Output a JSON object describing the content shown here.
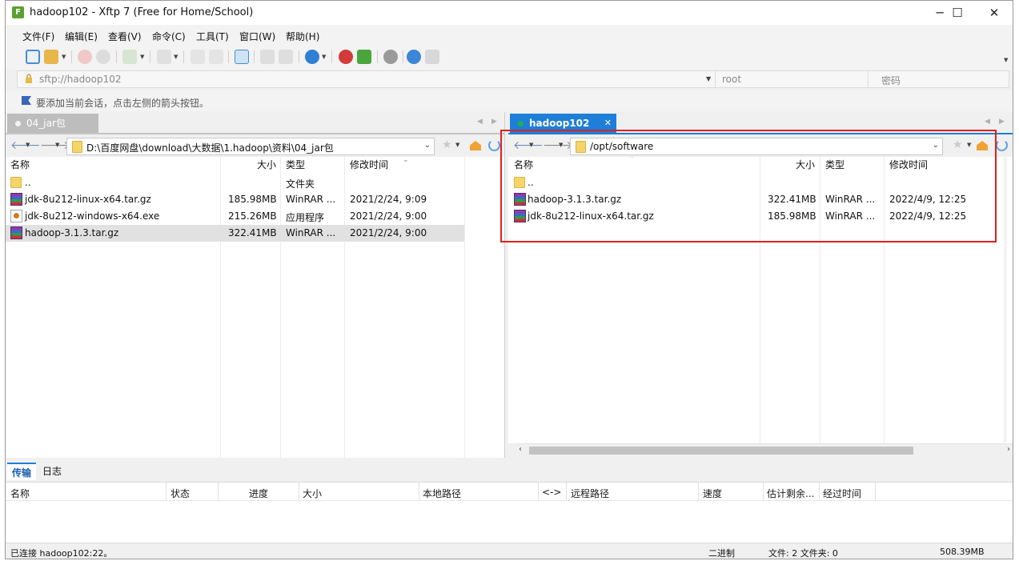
{
  "window": {
    "title": "hadoop102 - Xftp 7 (Free for Home/School)",
    "app_icon": "xftp-icon",
    "minimize": "─",
    "maximize": "☐",
    "close": "✕"
  },
  "menu": [
    "文件(F)",
    "编辑(E)",
    "查看(V)",
    "命令(C)",
    "工具(T)",
    "窗口(W)",
    "帮助(H)"
  ],
  "address": {
    "url": "sftp://hadoop102",
    "user_placeholder": "root",
    "password_placeholder": "密码"
  },
  "hint": "要添加当前会话，点击左侧的箭头按钮。",
  "left_pane": {
    "tab": "04_jar包",
    "path": "D:\\百度网盘\\download\\大数据\\1.hadoop\\资料\\04_jar包",
    "columns": [
      "名称",
      "大小",
      "类型",
      "修改时间"
    ],
    "rows": [
      {
        "icon": "folder-icon",
        "name": "..",
        "size": "",
        "type": "文件夹",
        "modified": ""
      },
      {
        "icon": "winrar-icon",
        "name": "jdk-8u212-linux-x64.tar.gz",
        "size": "185.98MB",
        "type": "WinRAR ...",
        "modified": "2021/2/24, 9:09"
      },
      {
        "icon": "exe-icon",
        "name": "jdk-8u212-windows-x64.exe",
        "size": "215.26MB",
        "type": "应用程序",
        "modified": "2021/2/24, 9:00"
      },
      {
        "icon": "winrar-icon",
        "name": "hadoop-3.1.3.tar.gz",
        "size": "322.41MB",
        "type": "WinRAR ...",
        "modified": "2021/2/24, 9:00",
        "selected": true
      }
    ]
  },
  "right_pane": {
    "tab": "hadoop102",
    "tab_status_color": "#22b14c",
    "path": "/opt/software",
    "columns": [
      "名称",
      "大小",
      "类型",
      "修改时间"
    ],
    "rows": [
      {
        "icon": "folder-icon",
        "name": "..",
        "size": "",
        "type": "",
        "modified": ""
      },
      {
        "icon": "winrar-icon",
        "name": "hadoop-3.1.3.tar.gz",
        "size": "322.41MB",
        "type": "WinRAR ...",
        "modified": "2022/4/9, 12:25"
      },
      {
        "icon": "winrar-icon",
        "name": "jdk-8u212-linux-x64.tar.gz",
        "size": "185.98MB",
        "type": "WinRAR ...",
        "modified": "2022/4/9, 12:25"
      }
    ]
  },
  "transfer": {
    "tabs": [
      "传输",
      "日志"
    ],
    "columns": [
      "名称",
      "状态",
      "进度",
      "大小",
      "本地路径",
      "<->",
      "远程路径",
      "速度",
      "估计剩余...",
      "经过时间"
    ]
  },
  "status_bar": {
    "connection": "已连接 hadoop102:22。",
    "mode": "二进制",
    "files": "文件: 2  文件夹: 0",
    "size": "508.39MB"
  },
  "colors": {
    "accent": "#1e7fd8",
    "highlight": "#e02020",
    "selected_row": "#e1e1e1"
  }
}
